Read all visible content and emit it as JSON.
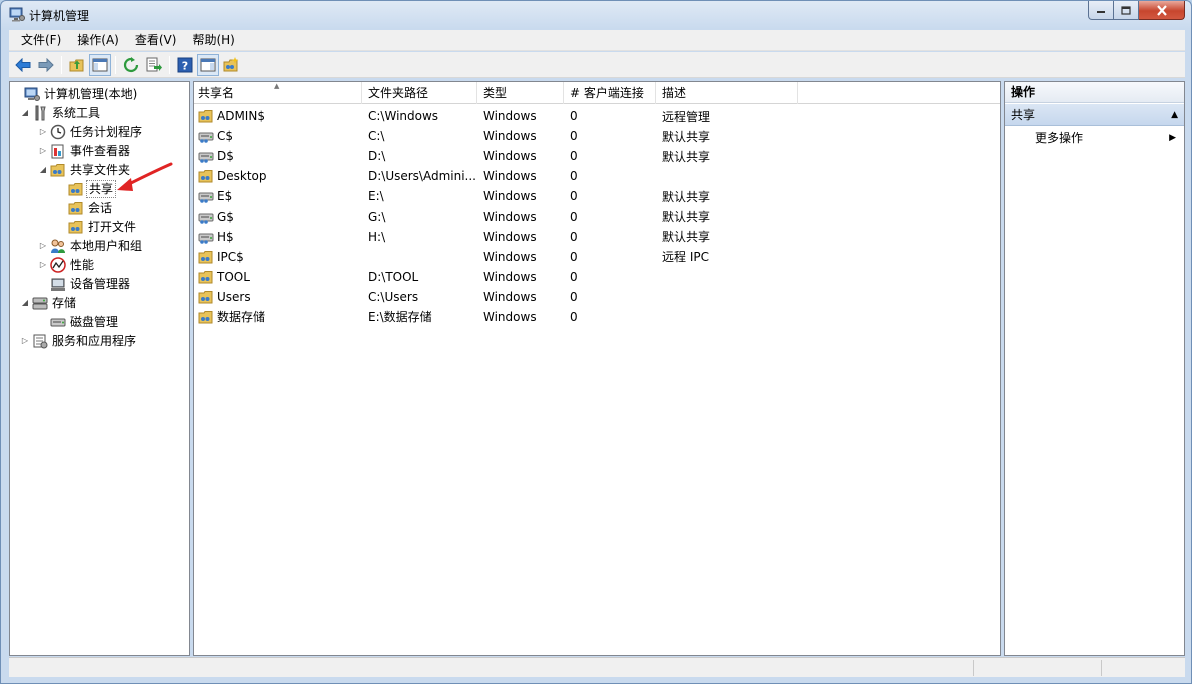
{
  "window": {
    "title": "计算机管理"
  },
  "menu": [
    {
      "label": "文件(F)"
    },
    {
      "label": "操作(A)"
    },
    {
      "label": "查看(V)"
    },
    {
      "label": "帮助(H)"
    }
  ],
  "toolbar": [
    {
      "icon": "back-arrow-icon"
    },
    {
      "icon": "forward-arrow-icon"
    },
    {
      "icon": "up-folder-icon"
    },
    {
      "icon": "show-hide-tree-icon"
    },
    {
      "icon": "refresh-icon"
    },
    {
      "icon": "export-list-icon"
    },
    {
      "icon": "help-icon"
    },
    {
      "icon": "show-hide-action-pane-icon"
    },
    {
      "icon": "new-share-icon"
    }
  ],
  "tree": [
    {
      "label": "计算机管理(本地)",
      "icon": "computer-management-icon",
      "level": 0,
      "expander": "none"
    },
    {
      "label": "系统工具",
      "icon": "system-tools-icon",
      "level": 1,
      "expander": "expanded"
    },
    {
      "label": "任务计划程序",
      "icon": "clock-icon",
      "level": 2,
      "expander": "collapsed"
    },
    {
      "label": "事件查看器",
      "icon": "event-viewer-icon",
      "level": 2,
      "expander": "collapsed"
    },
    {
      "label": "共享文件夹",
      "icon": "shared-folder-icon",
      "level": 2,
      "expander": "expanded"
    },
    {
      "label": "共享",
      "icon": "share-icon",
      "level": 3,
      "expander": "none",
      "selected": true
    },
    {
      "label": "会话",
      "icon": "session-icon",
      "level": 3,
      "expander": "none"
    },
    {
      "label": "打开文件",
      "icon": "open-files-icon",
      "level": 3,
      "expander": "none"
    },
    {
      "label": "本地用户和组",
      "icon": "users-icon",
      "level": 2,
      "expander": "collapsed"
    },
    {
      "label": "性能",
      "icon": "performance-icon",
      "level": 2,
      "expander": "collapsed"
    },
    {
      "label": "设备管理器",
      "icon": "device-manager-icon",
      "level": 2,
      "expander": "none"
    },
    {
      "label": "存储",
      "icon": "storage-icon",
      "level": 1,
      "expander": "expanded"
    },
    {
      "label": "磁盘管理",
      "icon": "disk-management-icon",
      "level": 2,
      "expander": "none"
    },
    {
      "label": "服务和应用程序",
      "icon": "services-icon",
      "level": 1,
      "expander": "collapsed"
    }
  ],
  "list": {
    "columns": [
      "共享名",
      "文件夹路径",
      "类型",
      "# 客户端连接",
      "描述"
    ],
    "rows": [
      {
        "name": "ADMIN$",
        "path": "C:\\Windows",
        "type": "Windows",
        "clients": "0",
        "desc": "远程管理",
        "icon": "hidden-share-icon"
      },
      {
        "name": "C$",
        "path": "C:\\",
        "type": "Windows",
        "clients": "0",
        "desc": "默认共享",
        "icon": "drive-share-icon"
      },
      {
        "name": "D$",
        "path": "D:\\",
        "type": "Windows",
        "clients": "0",
        "desc": "默认共享",
        "icon": "drive-share-icon"
      },
      {
        "name": "Desktop",
        "path": "D:\\Users\\Admini...",
        "type": "Windows",
        "clients": "0",
        "desc": "",
        "icon": "folder-share-icon"
      },
      {
        "name": "E$",
        "path": "E:\\",
        "type": "Windows",
        "clients": "0",
        "desc": "默认共享",
        "icon": "drive-share-icon"
      },
      {
        "name": "G$",
        "path": "G:\\",
        "type": "Windows",
        "clients": "0",
        "desc": "默认共享",
        "icon": "drive-share-icon"
      },
      {
        "name": "H$",
        "path": "H:\\",
        "type": "Windows",
        "clients": "0",
        "desc": "默认共享",
        "icon": "drive-share-icon"
      },
      {
        "name": "IPC$",
        "path": "",
        "type": "Windows",
        "clients": "0",
        "desc": "远程 IPC",
        "icon": "folder-share-icon"
      },
      {
        "name": "TOOL",
        "path": "D:\\TOOL",
        "type": "Windows",
        "clients": "0",
        "desc": "",
        "icon": "folder-share-icon"
      },
      {
        "name": "Users",
        "path": "C:\\Users",
        "type": "Windows",
        "clients": "0",
        "desc": "",
        "icon": "folder-share-icon"
      },
      {
        "name": "数据存储",
        "path": "E:\\数据存储",
        "type": "Windows",
        "clients": "0",
        "desc": "",
        "icon": "folder-share-icon"
      }
    ]
  },
  "actions": {
    "title": "操作",
    "section": "共享",
    "more": "更多操作"
  },
  "colors": {
    "accent": "#c6d7ed",
    "titlebar": "#c9daee",
    "close_button": "#c7462e",
    "annotation_arrow": "#e02424"
  }
}
